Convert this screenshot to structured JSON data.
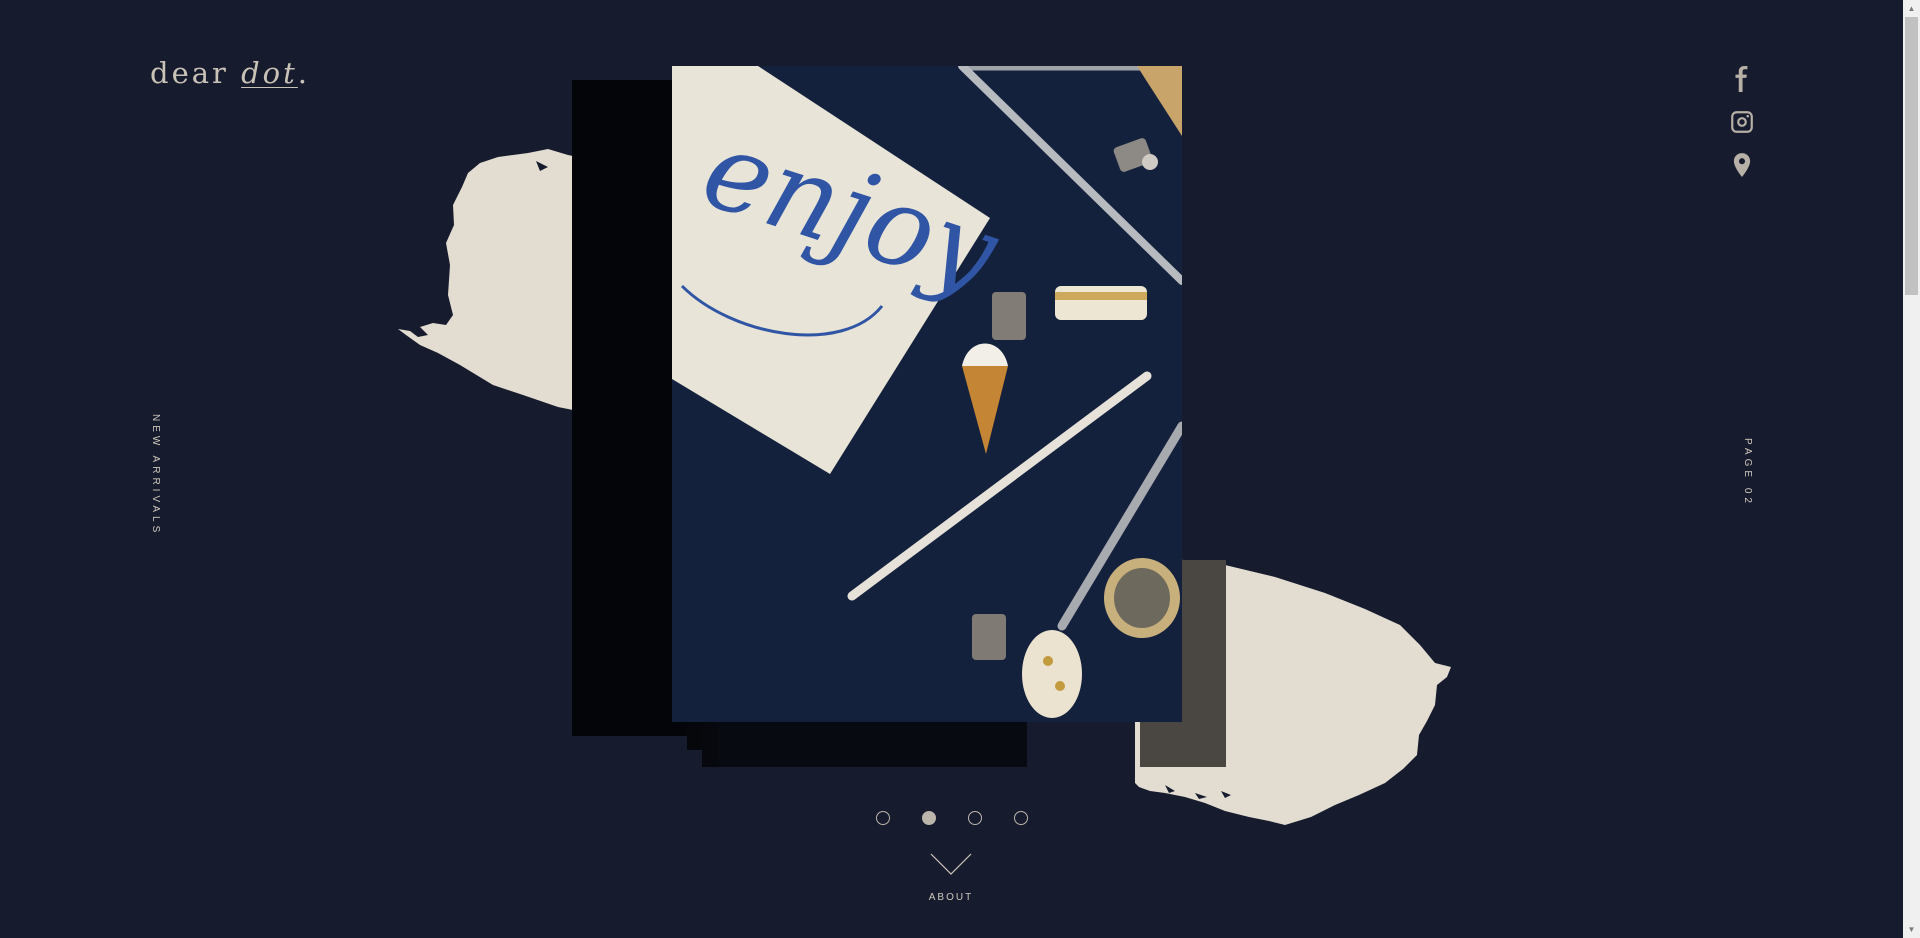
{
  "logo": {
    "prefix": "dear ",
    "emph": "dot",
    "suffix": "."
  },
  "social": [
    {
      "name": "facebook-icon"
    },
    {
      "name": "instagram-icon"
    },
    {
      "name": "location-pin-icon"
    }
  ],
  "side": {
    "left_label": "NEW ARRIVALS",
    "right_label": "PAGE 02"
  },
  "pager": {
    "count": 4,
    "active_index": 1
  },
  "scroll_hint": {
    "label": "ABOUT",
    "icon": "chevron-down-icon"
  },
  "colors": {
    "background": "#161b2e",
    "brush": "#e3ddd1",
    "text": "#cfc8bc",
    "photo_bg": "#14213d",
    "ink": "#2f55a4"
  },
  "photo": {
    "card_text": "enjoy"
  }
}
